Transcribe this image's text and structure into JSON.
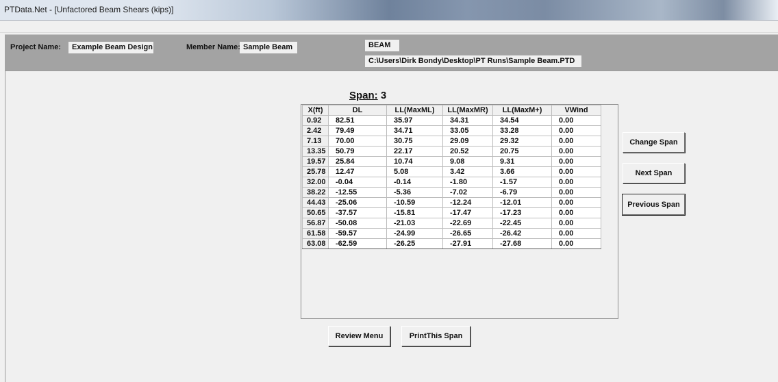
{
  "window": {
    "title": "PTData.Net - [Unfactored Beam Shears (kips)]"
  },
  "info": {
    "project_label": "Project Name:",
    "project_value": "Example Beam Design",
    "member_label": "Member Name:",
    "member_value": "Sample Beam",
    "type_value": "BEAM",
    "path_value": "C:\\Users\\Dirk Bondy\\Desktop\\PT Runs\\Sample Beam.PTD"
  },
  "span": {
    "label": "Span:",
    "number": "3"
  },
  "grid": {
    "columns": [
      "X(ft)",
      "DL",
      "LL(MaxML)",
      "LL(MaxMR)",
      "LL(MaxM+)",
      "VWind"
    ],
    "rows": [
      [
        "0.92",
        "82.51",
        "35.97",
        "34.31",
        "34.54",
        "0.00"
      ],
      [
        "2.42",
        "79.49",
        "34.71",
        "33.05",
        "33.28",
        "0.00"
      ],
      [
        "7.13",
        "70.00",
        "30.75",
        "29.09",
        "29.32",
        "0.00"
      ],
      [
        "13.35",
        "50.79",
        "22.17",
        "20.52",
        "20.75",
        "0.00"
      ],
      [
        "19.57",
        "25.84",
        "10.74",
        "9.08",
        "9.31",
        "0.00"
      ],
      [
        "25.78",
        "12.47",
        "5.08",
        "3.42",
        "3.66",
        "0.00"
      ],
      [
        "32.00",
        "-0.04",
        "-0.14",
        "-1.80",
        "-1.57",
        "0.00"
      ],
      [
        "38.22",
        "-12.55",
        "-5.36",
        "-7.02",
        "-6.79",
        "0.00"
      ],
      [
        "44.43",
        "-25.06",
        "-10.59",
        "-12.24",
        "-12.01",
        "0.00"
      ],
      [
        "50.65",
        "-37.57",
        "-15.81",
        "-17.47",
        "-17.23",
        "0.00"
      ],
      [
        "56.87",
        "-50.08",
        "-21.03",
        "-22.69",
        "-22.45",
        "0.00"
      ],
      [
        "61.58",
        "-59.57",
        "-24.99",
        "-26.65",
        "-26.42",
        "0.00"
      ],
      [
        "63.08",
        "-62.59",
        "-26.25",
        "-27.91",
        "-27.68",
        "0.00"
      ]
    ]
  },
  "buttons": {
    "change_span": "Change Span",
    "next_span": "Next Span",
    "previous_span": "Previous Span",
    "review_menu": "Review Menu",
    "print_span": "PrintThis Span"
  }
}
